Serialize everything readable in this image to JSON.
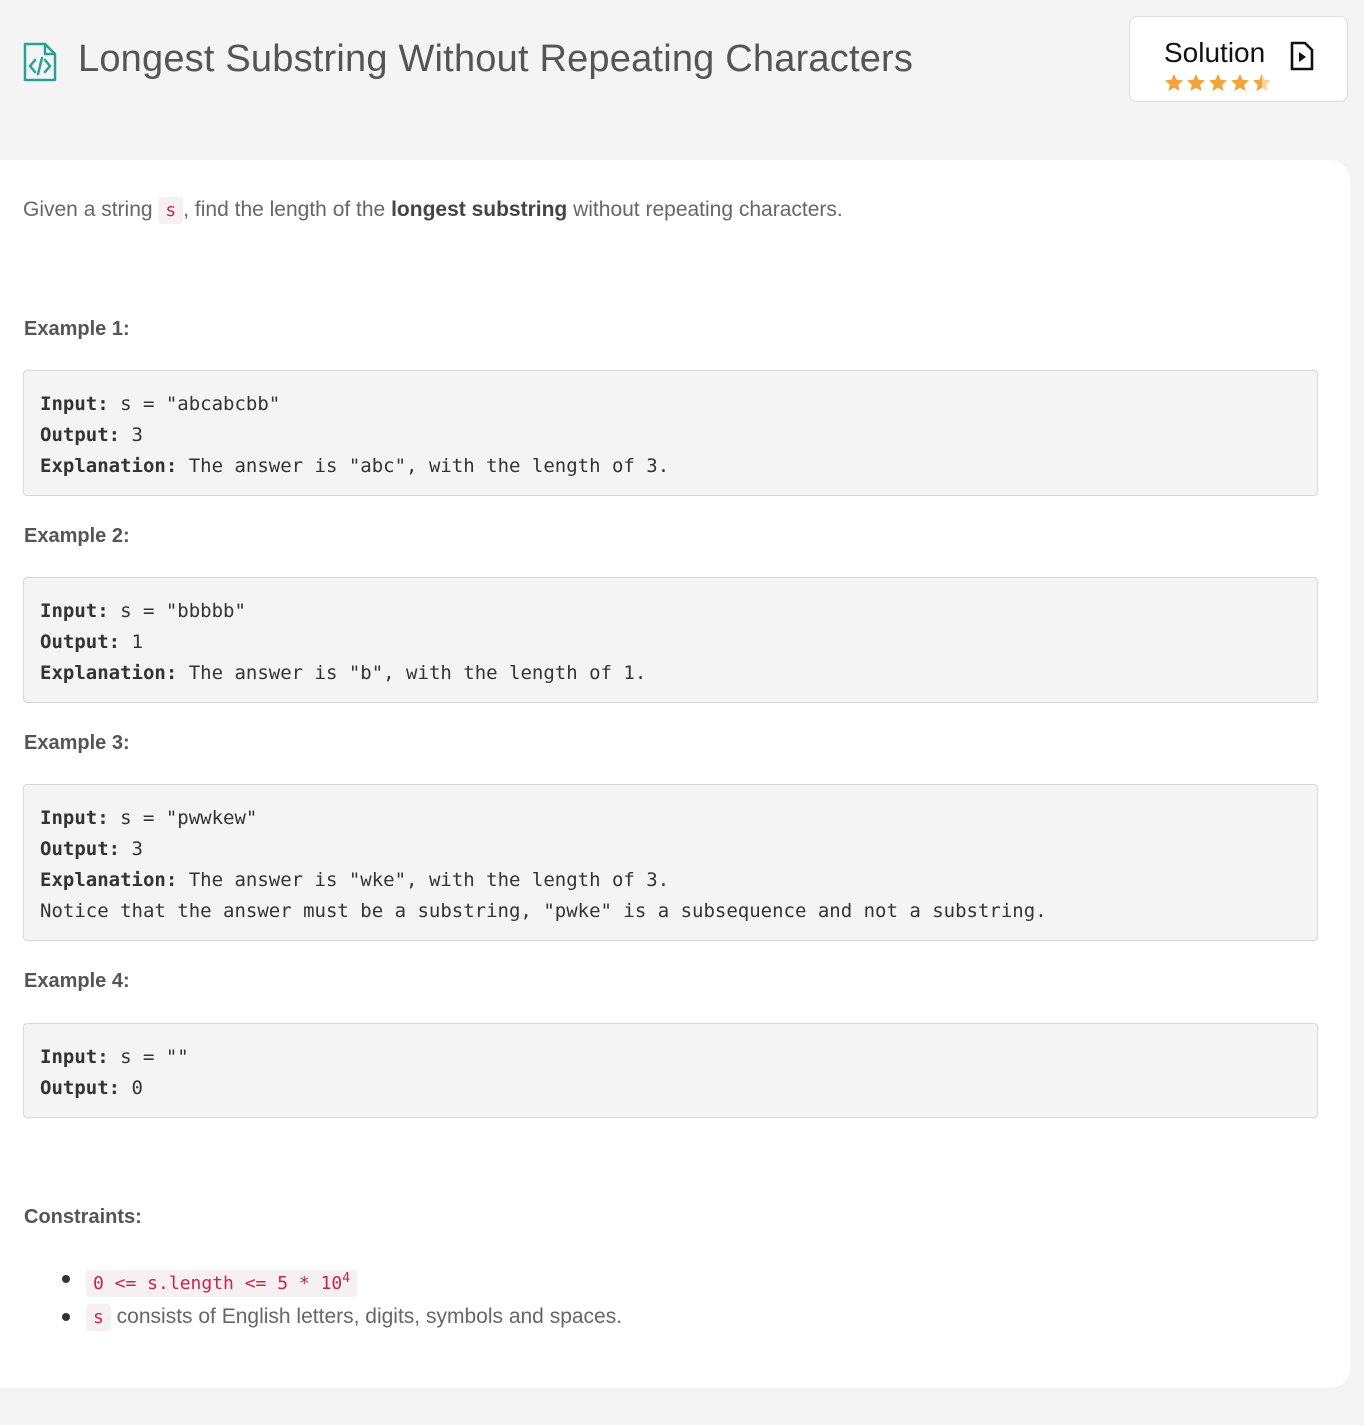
{
  "header": {
    "title": "Longest Substring Without Repeating Characters",
    "icon": "code-file-icon",
    "solution_label": "Solution",
    "solution_icon": "play-document-icon",
    "rating_stars": 4.5,
    "accent_color": "#2aa198",
    "star_color": "#f0a43a"
  },
  "description": {
    "prefix": "Given a string ",
    "code": "s",
    "middle": ", find the length of the ",
    "bold": "longest substring",
    "suffix": " without repeating characters."
  },
  "examples": [
    {
      "title": "Example 1:",
      "input_label": "Input:",
      "input": " s = \"abcabcbb\"",
      "output_label": "Output:",
      "output": " 3",
      "explanation_label": "Explanation:",
      "explanation": " The answer is \"abc\", with the length of 3.",
      "note": ""
    },
    {
      "title": "Example 2:",
      "input_label": "Input:",
      "input": " s = \"bbbbb\"",
      "output_label": "Output:",
      "output": " 1",
      "explanation_label": "Explanation:",
      "explanation": " The answer is \"b\", with the length of 1.",
      "note": ""
    },
    {
      "title": "Example 3:",
      "input_label": "Input:",
      "input": " s = \"pwwkew\"",
      "output_label": "Output:",
      "output": " 3",
      "explanation_label": "Explanation:",
      "explanation": " The answer is \"wke\", with the length of 3.",
      "note": "Notice that the answer must be a substring, \"pwke\" is a subsequence and not a substring."
    },
    {
      "title": "Example 4:",
      "input_label": "Input:",
      "input": " s = \"\"",
      "output_label": "Output:",
      "output": " 0"
    }
  ],
  "constraints": {
    "title": "Constraints:",
    "c1_code": "0 <= s.length <= 5 * 10",
    "c1_sup": "4",
    "c2_code": "s",
    "c2_text": " consists of English letters, digits, symbols and spaces."
  }
}
